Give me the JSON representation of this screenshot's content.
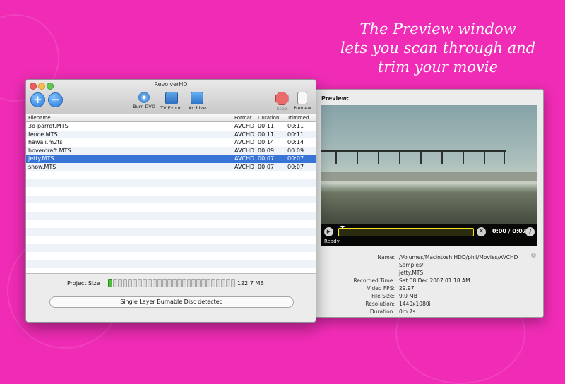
{
  "caption": {
    "lines": [
      "The Preview window",
      "lets you scan through and",
      "trim your movie"
    ]
  },
  "main_window": {
    "title": "RevolverHD",
    "toolbar": {
      "add_icon": "+",
      "remove_icon": "−",
      "burn_dvd": "Burn DVD",
      "tv_export": "TV Export",
      "archive": "Archive",
      "stop": "Stop",
      "preview": "Preview"
    },
    "table": {
      "headers": {
        "filename": "Filename",
        "format": "Format",
        "duration": "Duration",
        "trimmed": "Trimmed"
      },
      "rows": [
        {
          "filename": "3d-parrot.MTS",
          "format": "AVCHD",
          "duration": "00:11",
          "trimmed": "00:11",
          "selected": false
        },
        {
          "filename": "fence.MTS",
          "format": "AVCHD",
          "duration": "00:11",
          "trimmed": "00:11",
          "selected": false
        },
        {
          "filename": "hawaii.m2ts",
          "format": "AVCHD",
          "duration": "00:14",
          "trimmed": "00:14",
          "selected": false
        },
        {
          "filename": "hovercraft.MTS",
          "format": "AVCHD",
          "duration": "00:09",
          "trimmed": "00:09",
          "selected": false
        },
        {
          "filename": "jetty.MTS",
          "format": "AVCHD",
          "duration": "00:07",
          "trimmed": "00:07",
          "selected": true
        },
        {
          "filename": "snow.MTS",
          "format": "AVCHD",
          "duration": "00:07",
          "trimmed": "00:07",
          "selected": false
        }
      ]
    },
    "project_size_label": "Project Size",
    "project_size_value": "122.7 MB",
    "project_fill_fraction": 0.04,
    "disc_status": "Single Layer Burnable Disc detected"
  },
  "preview_window": {
    "label": "Preview:",
    "time": "0:00 / 0:07",
    "status": "Ready",
    "info_icon": "i",
    "info": {
      "name_label": "Name:",
      "name_value": "/Volumes/Macintosh HDD/phil/Movies/AVCHD Samples/",
      "name_value_2": "jetty.MTS",
      "recorded_label": "Recorded Time:",
      "recorded_value": "Sat 08 Dec 2007 01:18 AM",
      "fps_label": "Video FPS:",
      "fps_value": "29.97",
      "size_label": "File Size:",
      "size_value": "9.0 MB",
      "resolution_label": "Resolution:",
      "resolution_value": "1440x1080i",
      "duration_label": "Duration:",
      "duration_value": "0m 7s"
    }
  },
  "colors": {
    "background": "#f02cb6",
    "selection": "#3875d7",
    "meter_fill": "#4cbf3a",
    "scrub_border": "#f5e41e"
  }
}
